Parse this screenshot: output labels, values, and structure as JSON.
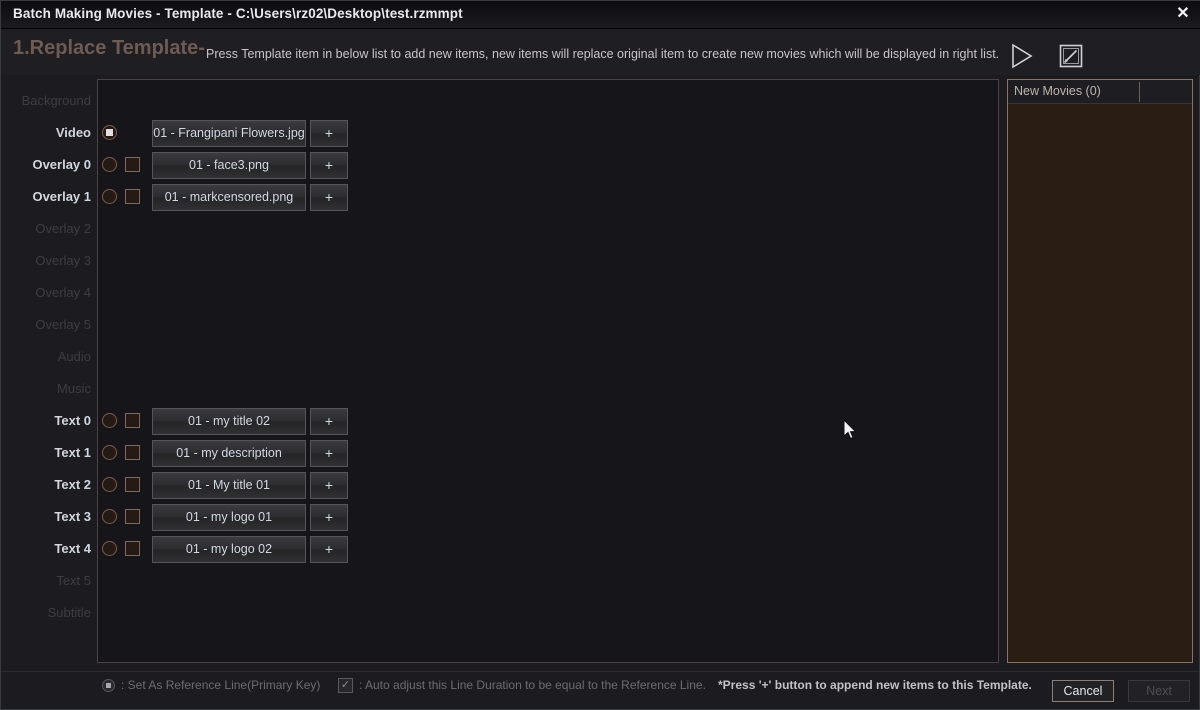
{
  "window": {
    "title": "Batch Making Movies - Template - C:\\Users\\rz02\\Desktop\\test.rzmmpt",
    "close_label": "✕"
  },
  "header": {
    "step_title": "1.Replace Template-",
    "description": "Press Template item in below list to add new items, new items will replace original item to create new movies which will be displayed in right list.",
    "play_icon": "play-icon",
    "edit_icon": "edit-icon"
  },
  "rows": [
    {
      "label": "Background",
      "enabled": false,
      "radio": false,
      "radio_checked": false,
      "checkbox": false,
      "item": null,
      "plus": null
    },
    {
      "label": "Video",
      "enabled": true,
      "radio": true,
      "radio_checked": true,
      "checkbox": false,
      "item": "01 - Frangipani Flowers.jpg",
      "plus": "+"
    },
    {
      "label": "Overlay 0",
      "enabled": true,
      "radio": true,
      "radio_checked": false,
      "checkbox": true,
      "item": "01 - face3.png",
      "plus": "+"
    },
    {
      "label": "Overlay 1",
      "enabled": true,
      "radio": true,
      "radio_checked": false,
      "checkbox": true,
      "item": "01 - markcensored.png",
      "plus": "+"
    },
    {
      "label": "Overlay 2",
      "enabled": false,
      "radio": false,
      "radio_checked": false,
      "checkbox": false,
      "item": null,
      "plus": null
    },
    {
      "label": "Overlay 3",
      "enabled": false,
      "radio": false,
      "radio_checked": false,
      "checkbox": false,
      "item": null,
      "plus": null
    },
    {
      "label": "Overlay 4",
      "enabled": false,
      "radio": false,
      "radio_checked": false,
      "checkbox": false,
      "item": null,
      "plus": null
    },
    {
      "label": "Overlay 5",
      "enabled": false,
      "radio": false,
      "radio_checked": false,
      "checkbox": false,
      "item": null,
      "plus": null
    },
    {
      "label": "Audio",
      "enabled": false,
      "radio": false,
      "radio_checked": false,
      "checkbox": false,
      "item": null,
      "plus": null
    },
    {
      "label": "Music",
      "enabled": false,
      "radio": false,
      "radio_checked": false,
      "checkbox": false,
      "item": null,
      "plus": null
    },
    {
      "label": "Text 0",
      "enabled": true,
      "radio": true,
      "radio_checked": false,
      "checkbox": true,
      "item": "01 - my title 02",
      "plus": "+"
    },
    {
      "label": "Text 1",
      "enabled": true,
      "radio": true,
      "radio_checked": false,
      "checkbox": true,
      "item": "01 - my description",
      "plus": "+"
    },
    {
      "label": "Text 2",
      "enabled": true,
      "radio": true,
      "radio_checked": false,
      "checkbox": true,
      "item": "01 - My title 01",
      "plus": "+"
    },
    {
      "label": "Text 3",
      "enabled": true,
      "radio": true,
      "radio_checked": false,
      "checkbox": true,
      "item": "01 - my logo 01",
      "plus": "+"
    },
    {
      "label": "Text 4",
      "enabled": true,
      "radio": true,
      "radio_checked": false,
      "checkbox": true,
      "item": "01 - my logo 02",
      "plus": "+"
    },
    {
      "label": "Text 5",
      "enabled": false,
      "radio": false,
      "radio_checked": false,
      "checkbox": false,
      "item": null,
      "plus": null
    },
    {
      "label": "Subtitle",
      "enabled": false,
      "radio": false,
      "radio_checked": false,
      "checkbox": false,
      "item": null,
      "plus": null
    }
  ],
  "right_panel": {
    "header_title": "New Movies (0)",
    "items": []
  },
  "footer": {
    "legend_reference": ": Set As Reference Line(Primary Key)",
    "legend_checkbox_mark": "✓",
    "legend_autoadjust": ": Auto adjust this Line Duration to be equal to the Reference Line.",
    "note": "*Press '+' button to append new items to this Template.",
    "cancel_label": "Cancel",
    "next_label": "Next"
  },
  "colors": {
    "accent_brown": "#8a7363",
    "panel_bg": "#16161a",
    "right_panel_bg": "#2a1d14",
    "title_text": "#e8e8ee",
    "step_title": "#6e5b52"
  }
}
